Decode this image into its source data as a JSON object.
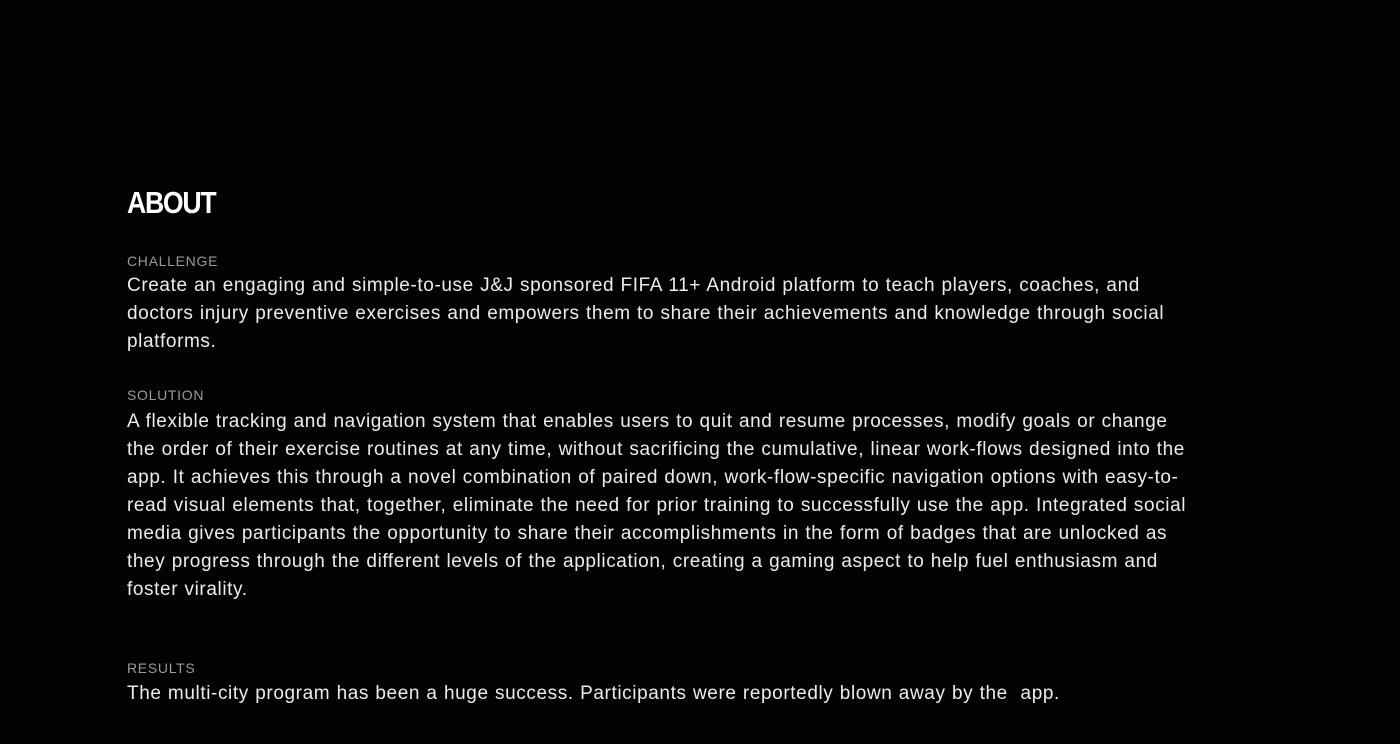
{
  "about": {
    "heading": "ABOUT",
    "challenge": {
      "label": "CHALLENGE",
      "text": "Create an engaging and simple-to-use J&J sponsored FIFA 11+ Android platform to teach players, coaches, and doctors injury preventive exercises and empowers them to share their achievements and knowledge through social platforms."
    },
    "solution": {
      "label": "SOLUTION",
      "text": "A flexible tracking and navigation system that enables users to quit and resume processes, modify goals or change the order of their exercise routines at any time, without sacrificing the cumulative, linear work-flows designed into the app. It achieves this through a novel combination of paired down, work-flow-specific navigation options with easy-to-read visual elements that, together, eliminate the need for prior training to successfully use the app. Integrated social media gives participants the opportunity to share their accomplishments in the form of badges that are unlocked as they progress through the different levels of the application, creating a gaming aspect to help fuel enthusiasm and foster virality."
    },
    "results": {
      "label": "RESULTS",
      "text": "The multi-city program has been a huge success. Participants were reportedly blown away by the  app."
    }
  }
}
